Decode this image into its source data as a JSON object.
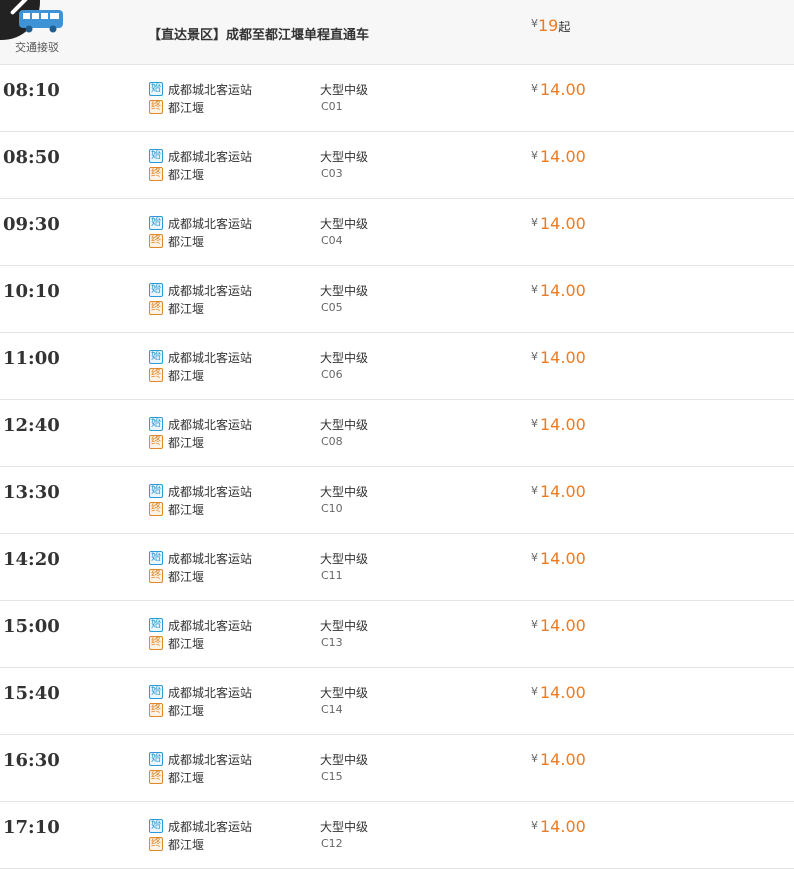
{
  "header": {
    "category_label": "交通接驳",
    "title": "【直达景区】成都至都江堰单程直通车",
    "price": {
      "currency": "¥",
      "amount": "19",
      "suffix": "起"
    }
  },
  "tags": {
    "start": "始",
    "end": "终"
  },
  "currency": "¥",
  "colors": {
    "price": "#f07a1e",
    "start_tag": "#2a9bd8",
    "end_tag": "#e0882a"
  },
  "icons": {
    "category": "bus-icon"
  },
  "departures": [
    {
      "time": "08:10",
      "from": "成都城北客运站",
      "to": "都江堰",
      "bus_type": "大型中级",
      "code": "C01",
      "price": "14.00"
    },
    {
      "time": "08:50",
      "from": "成都城北客运站",
      "to": "都江堰",
      "bus_type": "大型中级",
      "code": "C03",
      "price": "14.00"
    },
    {
      "time": "09:30",
      "from": "成都城北客运站",
      "to": "都江堰",
      "bus_type": "大型中级",
      "code": "C04",
      "price": "14.00"
    },
    {
      "time": "10:10",
      "from": "成都城北客运站",
      "to": "都江堰",
      "bus_type": "大型中级",
      "code": "C05",
      "price": "14.00"
    },
    {
      "time": "11:00",
      "from": "成都城北客运站",
      "to": "都江堰",
      "bus_type": "大型中级",
      "code": "C06",
      "price": "14.00"
    },
    {
      "time": "12:40",
      "from": "成都城北客运站",
      "to": "都江堰",
      "bus_type": "大型中级",
      "code": "C08",
      "price": "14.00"
    },
    {
      "time": "13:30",
      "from": "成都城北客运站",
      "to": "都江堰",
      "bus_type": "大型中级",
      "code": "C10",
      "price": "14.00"
    },
    {
      "time": "14:20",
      "from": "成都城北客运站",
      "to": "都江堰",
      "bus_type": "大型中级",
      "code": "C11",
      "price": "14.00"
    },
    {
      "time": "15:00",
      "from": "成都城北客运站",
      "to": "都江堰",
      "bus_type": "大型中级",
      "code": "C13",
      "price": "14.00"
    },
    {
      "time": "15:40",
      "from": "成都城北客运站",
      "to": "都江堰",
      "bus_type": "大型中级",
      "code": "C14",
      "price": "14.00"
    },
    {
      "time": "16:30",
      "from": "成都城北客运站",
      "to": "都江堰",
      "bus_type": "大型中级",
      "code": "C15",
      "price": "14.00"
    },
    {
      "time": "17:10",
      "from": "成都城北客运站",
      "to": "都江堰",
      "bus_type": "大型中级",
      "code": "C12",
      "price": "14.00"
    }
  ]
}
